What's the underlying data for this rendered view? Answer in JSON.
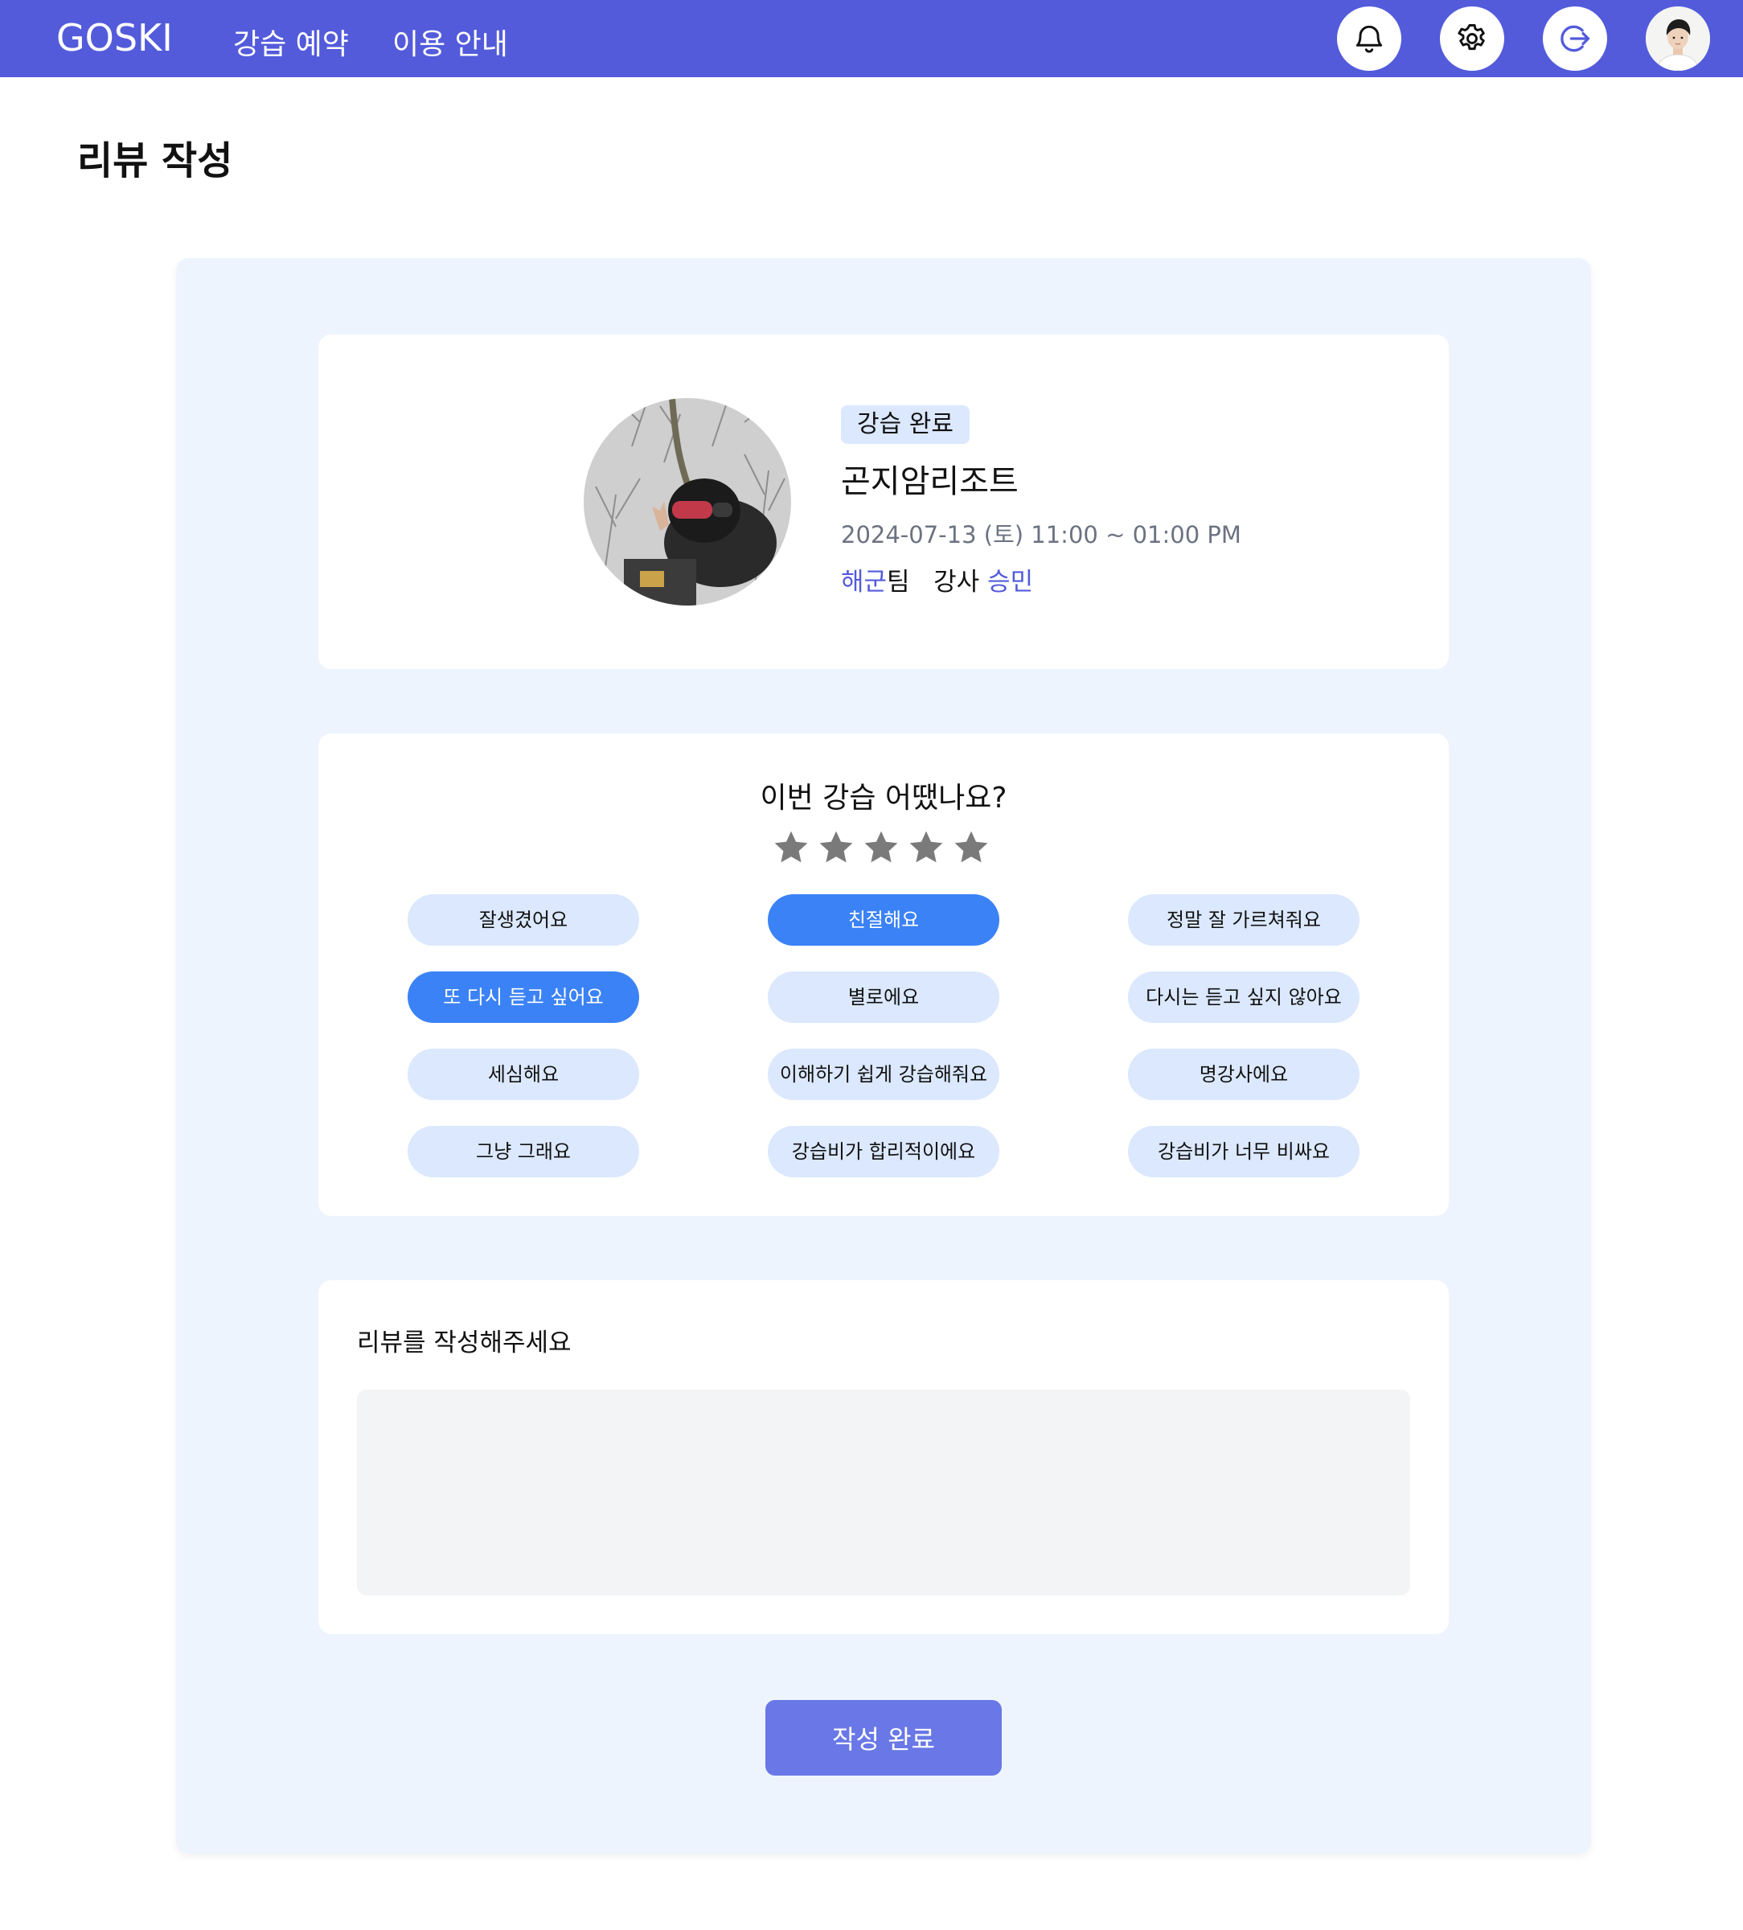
{
  "header": {
    "logo": "GOSKI",
    "nav": [
      "강습 예약",
      "이용 안내"
    ],
    "icons": [
      "bell-icon",
      "gear-icon",
      "logout-icon",
      "user-avatar"
    ],
    "brand_color": "#535bdb"
  },
  "page": {
    "title": "리뷰 작성"
  },
  "lesson": {
    "status": "강습 완료",
    "resort": "곤지암리조트",
    "datetime": "2024-07-13 (토) 11:00 ~ 01:00 PM",
    "team_name": "해군",
    "team_suffix": "팀",
    "instructor_label": "강사",
    "instructor_name": "승민"
  },
  "rating": {
    "question": "이번 강습 어땠나요?",
    "stars_total": 5,
    "stars_selected": 0,
    "star_color": "#7a7a7a"
  },
  "tags": [
    {
      "label": "잘생겼어요",
      "selected": false
    },
    {
      "label": "친절해요",
      "selected": true
    },
    {
      "label": "정말 잘 가르쳐줘요",
      "selected": false
    },
    {
      "label": "또 다시 듣고 싶어요",
      "selected": true
    },
    {
      "label": "별로에요",
      "selected": false
    },
    {
      "label": "다시는 듣고 싶지 않아요",
      "selected": false
    },
    {
      "label": "세심해요",
      "selected": false
    },
    {
      "label": "이해하기 쉽게 강습해줘요",
      "selected": false
    },
    {
      "label": "명강사에요",
      "selected": false
    },
    {
      "label": "그냥 그래요",
      "selected": false
    },
    {
      "label": "강습비가 합리적이에요",
      "selected": false
    },
    {
      "label": "강습비가 너무 비싸요",
      "selected": false
    }
  ],
  "review": {
    "label": "리뷰를 작성해주세요",
    "value": "",
    "placeholder": ""
  },
  "submit": {
    "label": "작성 완료"
  }
}
